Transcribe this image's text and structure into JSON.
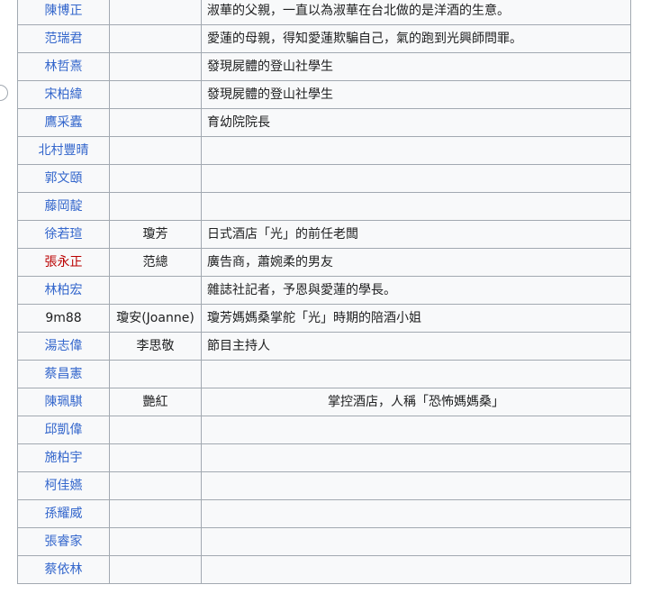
{
  "colors": {
    "link": "#3366cc",
    "redlink": "#ba0000",
    "text": "#202122",
    "border": "#a2a9b1",
    "table_bg": "#f8f9fa"
  },
  "cast_table": {
    "rows": [
      {
        "actor": "陳博正",
        "actor_style": "link",
        "role": "",
        "description": "淑華的父親，一直以為淑華在台北做的是洋酒的生意。",
        "desc_align": "left"
      },
      {
        "actor": "范瑞君",
        "actor_style": "link",
        "role": "",
        "description": "愛蓮的母親，得知愛蓮欺騙自己，氣的跑到光興師問罪。",
        "desc_align": "left"
      },
      {
        "actor": "林哲熹",
        "actor_style": "link",
        "role": "",
        "description": "發現屍體的登山社學生",
        "desc_align": "left"
      },
      {
        "actor": "宋柏緯",
        "actor_style": "link",
        "role": "",
        "description": "發現屍體的登山社學生",
        "desc_align": "left"
      },
      {
        "actor": "鷹采蠹",
        "actor_style": "link",
        "role": "",
        "description": "育幼院院長",
        "desc_align": "left"
      },
      {
        "actor": "北村豐晴",
        "actor_style": "link",
        "role": "",
        "description": "",
        "desc_align": "left"
      },
      {
        "actor": "郭文頤",
        "actor_style": "link",
        "role": "",
        "description": "",
        "desc_align": "left"
      },
      {
        "actor": "藤岡靛",
        "actor_style": "link",
        "role": "",
        "description": "",
        "desc_align": "left"
      },
      {
        "actor": "徐若瑄",
        "actor_style": "link",
        "role": "瓊芳",
        "description": "日式酒店「光」的前任老闆",
        "desc_align": "left"
      },
      {
        "actor": "張永正",
        "actor_style": "redlink",
        "role": "范總",
        "description": "廣告商，蕭婉柔的男友",
        "desc_align": "left"
      },
      {
        "actor": "林柏宏",
        "actor_style": "link",
        "role": "",
        "description": "雜誌社記者，予恩與愛蓮的學長。",
        "desc_align": "left"
      },
      {
        "actor": "9m88",
        "actor_style": "plain",
        "role": "瓊安(Joanne)",
        "description": "瓊芳媽媽桑掌舵「光」時期的陪酒小姐",
        "desc_align": "left"
      },
      {
        "actor": "湯志偉",
        "actor_style": "link",
        "role": "李思敬",
        "description": "節目主持人",
        "desc_align": "left"
      },
      {
        "actor": "蔡昌憲",
        "actor_style": "link",
        "role": "",
        "description": "",
        "desc_align": "left"
      },
      {
        "actor": "陳珮騏",
        "actor_style": "link",
        "role": "艷紅",
        "description": "掌控酒店，人稱「恐怖媽媽桑」",
        "desc_align": "center"
      },
      {
        "actor": "邱凱偉",
        "actor_style": "link",
        "role": "",
        "description": "",
        "desc_align": "left"
      },
      {
        "actor": "施柏宇",
        "actor_style": "link",
        "role": "",
        "description": "",
        "desc_align": "left"
      },
      {
        "actor": "柯佳嬿",
        "actor_style": "link",
        "role": "",
        "description": "",
        "desc_align": "left"
      },
      {
        "actor": "孫耀威",
        "actor_style": "link",
        "role": "",
        "description": "",
        "desc_align": "left"
      },
      {
        "actor": "張睿家",
        "actor_style": "link",
        "role": "",
        "description": "",
        "desc_align": "left"
      },
      {
        "actor": "蔡依林",
        "actor_style": "link",
        "role": "",
        "description": "",
        "desc_align": "left"
      }
    ]
  }
}
